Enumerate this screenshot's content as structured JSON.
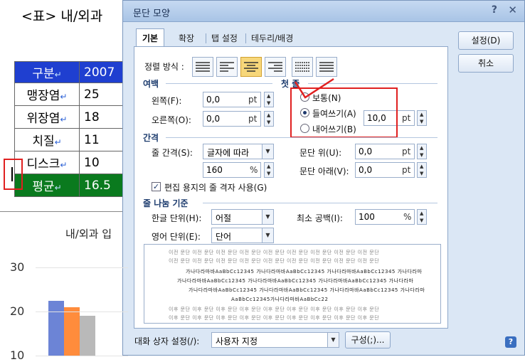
{
  "document": {
    "title": "<표> 내/외과",
    "table": {
      "header": [
        "구분",
        "2007"
      ],
      "rows": [
        [
          "맹장염",
          "25"
        ],
        [
          "위장염",
          "18"
        ],
        [
          "치질",
          "11"
        ],
        [
          "디스크",
          "10"
        ]
      ],
      "footer": [
        "평균",
        "16.5"
      ]
    },
    "return_mark": "↵",
    "chart": {
      "title": "내/외과 입"
    }
  },
  "chart_data": {
    "type": "bar",
    "title": "내/외과 입",
    "y_ticks": [
      "30",
      "20",
      "10"
    ],
    "ylim": [
      10,
      30
    ],
    "series": [
      {
        "values": [
          22.5
        ],
        "color": "#6c84d6"
      },
      {
        "values": [
          21.0
        ],
        "color": "#ff8c3c"
      },
      {
        "values": [
          19.0
        ],
        "color": "#b9b9b9"
      }
    ]
  },
  "dialog": {
    "title": "문단 모양",
    "help": "?",
    "close": "✕",
    "tabs": [
      {
        "label": "기본"
      },
      {
        "label": "확장"
      },
      {
        "label": "탭 설정"
      },
      {
        "label": "테두리/배경"
      }
    ],
    "alignment": {
      "label": "정렬 방식 :",
      "selected": 3
    },
    "margin": {
      "section": "여백",
      "left": {
        "label": "왼쪽(F):",
        "value": "0,0",
        "unit": "pt"
      },
      "right": {
        "label": "오른쪽(O):",
        "value": "0,0",
        "unit": "pt"
      }
    },
    "indent": {
      "section": "첫 줄",
      "options": [
        {
          "label": "보통(N)"
        },
        {
          "label": "들여쓰기(A)"
        },
        {
          "label": "내어쓰기(B)"
        }
      ],
      "selected": 1,
      "value": "10,0",
      "unit": "pt"
    },
    "spacing": {
      "section": "간격",
      "line_spacing": {
        "label": "줄 간격(S):",
        "type": "글자에 따라",
        "value": "160",
        "unit": "%"
      },
      "before": {
        "label": "문단 위(U):",
        "value": "0,0",
        "unit": "pt"
      },
      "after": {
        "label": "문단 아래(V):",
        "value": "0,0",
        "unit": "pt"
      },
      "grid_checkbox": {
        "label": "편집 용지의 줄 격자 사용(G)",
        "checked": true
      }
    },
    "line_break": {
      "section": "줄 나눔 기준",
      "hangul": {
        "label": "한글 단위(H):",
        "value": "어절"
      },
      "english": {
        "label": "영어 단위(E):",
        "value": "단어"
      },
      "min_space": {
        "label": "최소 공백(I):",
        "value": "100",
        "unit": "%"
      }
    },
    "preview": {
      "gray_line": "이전 문단 이전 문단 이전 문단 이전 문단 이전 문단 이전 문단 이전 문단 이전 문단 이전 문단",
      "dark_line": "가나다라마바AaBbCc12345 가나다라마바AaBbCc12345 가나다라마바AaBbCc12345 가나다라마",
      "last_dark": "AaBbCc12345가나다라마바AaBbCc22",
      "next_line": "이후 문단 이후 문단 이후 문단 이후 문단 이후 문단 이후 문단 이후 문단 이후 문단 이후 문단"
    },
    "buttons": {
      "ok": "설정(D)",
      "cancel": "취소"
    },
    "footer": {
      "label": "대화 상자 설정(/):",
      "preset": "사용자 지정",
      "config": "구성(;)..."
    }
  }
}
